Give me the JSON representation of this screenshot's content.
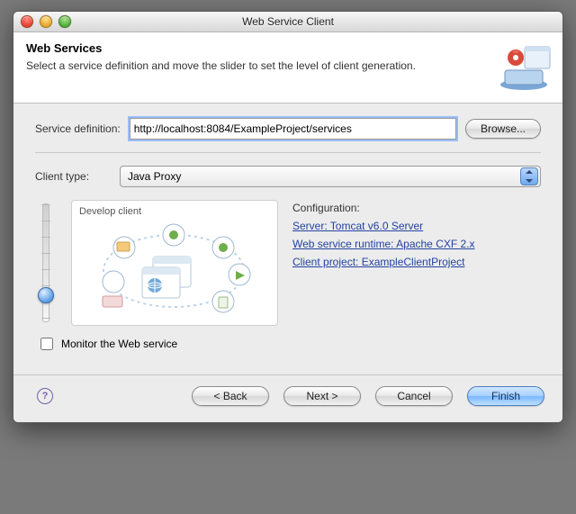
{
  "window": {
    "title": "Web Service Client"
  },
  "banner": {
    "heading": "Web Services",
    "description": "Select a service definition and move the slider to set the level of client generation."
  },
  "service_definition": {
    "label": "Service definition:",
    "value": "http://localhost:8084/ExampleProject/services",
    "browse": "Browse..."
  },
  "client_type": {
    "label": "Client type:",
    "value": "Java Proxy"
  },
  "preview": {
    "caption": "Develop client"
  },
  "configuration": {
    "heading": "Configuration:",
    "server": "Server: Tomcat v6.0 Server",
    "runtime": "Web service runtime: Apache CXF 2.x",
    "project": "Client project: ExampleClientProject"
  },
  "monitor": {
    "label": "Monitor the Web service",
    "checked": false
  },
  "buttons": {
    "back": "< Back",
    "next": "Next >",
    "cancel": "Cancel",
    "finish": "Finish"
  }
}
